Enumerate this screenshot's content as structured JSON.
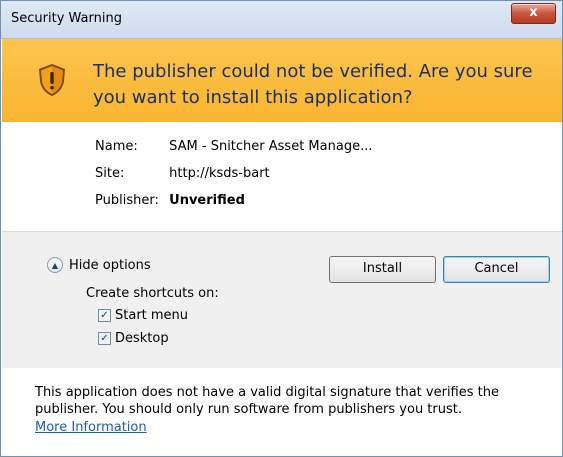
{
  "window": {
    "title": "Security Warning",
    "close_label": "x"
  },
  "banner": {
    "message": "The publisher could not be verified. Are you sure you want to install this application?"
  },
  "details": {
    "name_key": "Name:",
    "name_value": "SAM - Snitcher Asset Manage...",
    "site_key": "Site:",
    "site_value": "http://ksds-bart",
    "publisher_key": "Publisher:",
    "publisher_value": "Unverified"
  },
  "options": {
    "hide_label": "Hide options",
    "create_label": "Create shortcuts on:",
    "start_menu_label": "Start menu",
    "start_menu_checked": true,
    "desktop_label": "Desktop",
    "desktop_checked": true
  },
  "buttons": {
    "install": "Install",
    "cancel": "Cancel"
  },
  "footer": {
    "text": "This application does not have a valid digital signature that verifies the publisher. You should only run software from publishers you trust.",
    "link": "More Information"
  },
  "colors": {
    "banner": "#f9b530",
    "banner_text": "#1b2f5c",
    "link": "#1a5cc1"
  }
}
